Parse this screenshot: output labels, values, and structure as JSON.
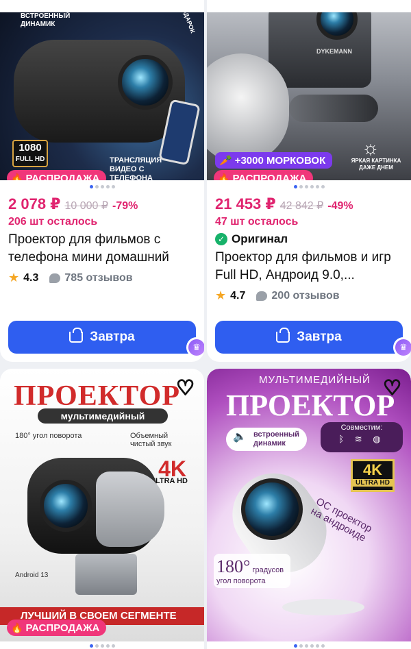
{
  "products": [
    {
      "image_badges": {
        "sale": "РАСПРОДАЖА",
        "speaker": "ВСТРОЕННЫЙ ДИНАМИК",
        "resolution_number": "1080",
        "resolution_text": "FULL HD",
        "cast": "ТРАНСЛЯЦИЯ ВИДЕО С ТЕЛЕФОНА",
        "gift": "ПОДАРОК"
      },
      "price": "2 078 ₽",
      "old_price": "10 000 ₽",
      "discount": "-79%",
      "stock": "206 шт осталось",
      "title": "Проектор для фильмов с телефона мини домашний",
      "rating": "4.3",
      "reviews": "785 отзывов",
      "button": "Завтра"
    },
    {
      "image_badges": {
        "sale": "РАСПРОДАЖА",
        "carrots": "+3000 МОРКОВОК",
        "bright": "ЯРКАЯ КАРТИНКА ДАЖЕ ДНЕМ",
        "brand": "DYKEMANN"
      },
      "price": "21 453 ₽",
      "old_price": "42 842 ₽",
      "discount": "-49%",
      "stock": "47 шт осталось",
      "original": "Оригинал",
      "title": "Проектор для фильмов и игр Full HD, Андроид 9.0,...",
      "rating": "4.7",
      "reviews": "200 отзывов",
      "button": "Завтра"
    },
    {
      "image_badges": {
        "headline": "ПРОЕКТОР",
        "sub": "мультимедийный",
        "rotate": "180° угол поворота",
        "sound": "Объемный чистый звук",
        "k4": "4K",
        "uhd": "ULTRA HD",
        "android": "Android 13",
        "best": "ЛУЧШИЙ В СВОЕМ СЕГМЕНТЕ",
        "sale": "РАСПРОДАЖА"
      }
    },
    {
      "image_badges": {
        "top": "МУЛЬТИМЕДИЙНЫЙ",
        "headline": "ПРОЕКТОР",
        "speaker": "встроенный динамик",
        "compat": "Совместим:",
        "k4": "4K",
        "uhd": "ULTRA HD",
        "os": "ОС проектор на андроиде",
        "deg_num": "180°",
        "deg_text": "градусов угол поворота"
      }
    }
  ],
  "colors": {
    "accent": "#2f5ef0",
    "price": "#e0246f",
    "sale": "#f0367a"
  }
}
